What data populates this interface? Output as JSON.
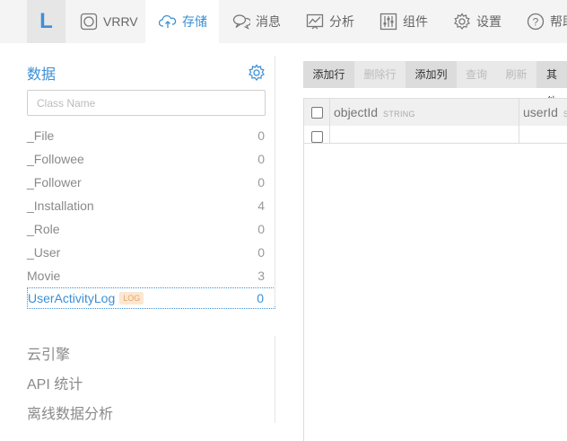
{
  "nav": {
    "logo": "L",
    "items": [
      {
        "label": "VRRV",
        "icon": "app-icon"
      },
      {
        "label": "存储",
        "icon": "cloud-upload-icon"
      },
      {
        "label": "消息",
        "icon": "chat-icon"
      },
      {
        "label": "分析",
        "icon": "chart-icon"
      },
      {
        "label": "组件",
        "icon": "sliders-icon"
      },
      {
        "label": "设置",
        "icon": "gear-icon"
      },
      {
        "label": "帮助",
        "icon": "help-icon"
      }
    ],
    "active": "存储"
  },
  "sidebar": {
    "title": "数据",
    "search_placeholder": "Class Name",
    "classes": [
      {
        "name": "_File",
        "count": "0"
      },
      {
        "name": "_Followee",
        "count": "0"
      },
      {
        "name": "_Follower",
        "count": "0"
      },
      {
        "name": "_Installation",
        "count": "4"
      },
      {
        "name": "_Role",
        "count": "0"
      },
      {
        "name": "_User",
        "count": "0"
      },
      {
        "name": "Movie",
        "count": "3"
      },
      {
        "name": "UserActivityLog",
        "count": "0",
        "badge": "LOG"
      }
    ],
    "sections": [
      "云引擎",
      "API 统计",
      "离线数据分析"
    ]
  },
  "toolbar": {
    "add_row": "添加行",
    "delete_row": "删除行",
    "add_column": "添加列",
    "query": "查询",
    "refresh": "刷新",
    "other": "其他"
  },
  "table": {
    "columns": [
      {
        "name": "objectId",
        "type": "STRING"
      },
      {
        "name": "userId",
        "type": "S"
      }
    ]
  },
  "colors": {
    "accent": "#3b8fd6",
    "badge_text": "#e8a664",
    "badge_bg": "#fbe7d2"
  }
}
